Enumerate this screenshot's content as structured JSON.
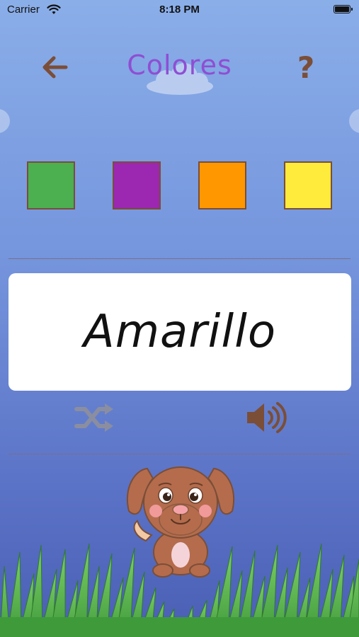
{
  "status_bar": {
    "carrier": "Carrier",
    "time": "8:18 PM"
  },
  "header": {
    "title": "Colores",
    "help_label": "?"
  },
  "swatches": [
    {
      "name": "green",
      "color": "#4caf50"
    },
    {
      "name": "purple",
      "color": "#9c27b0"
    },
    {
      "name": "orange",
      "color": "#ff9800"
    },
    {
      "name": "yellow",
      "color": "#ffeb3b"
    }
  ],
  "card": {
    "word": "Amarillo"
  },
  "colors": {
    "title": "#8f4ed3",
    "icon_brown": "#7b4e37",
    "shuffle_gray": "#8a8ea0",
    "background_top": "#8aaee8",
    "background_bottom": "#4a5fb4"
  },
  "icons": {
    "back": "arrow-left-icon",
    "shuffle": "shuffle-icon",
    "sound": "speaker-icon"
  }
}
